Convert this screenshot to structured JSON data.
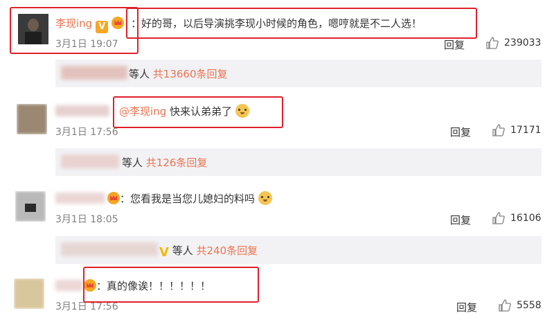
{
  "comments": [
    {
      "name": "李现ing",
      "text": "：好的哥，以后导演挑李现小时候的角色，嗯哼就是不二人选！",
      "time": "3月1日 19:07",
      "reply": "回复",
      "likes": "239033"
    },
    {
      "mention": "@李现ing",
      "text": " 快来认弟弟了",
      "time": "3月1日 17:56",
      "reply": "回复",
      "likes": "17171"
    },
    {
      "text": "：您看我是当您儿媳妇的料吗",
      "time": "3月1日 18:05",
      "reply": "回复",
      "likes": "16106"
    },
    {
      "text": "：真的像诶！！！！！！",
      "time": "3月1日 17:56",
      "reply": "回复",
      "likes": "5558"
    }
  ],
  "subreplies": [
    {
      "prefix": "等人",
      "link": "共13660条回复"
    },
    {
      "prefix": "等人",
      "link": "共126条回复"
    },
    {
      "prefix": "等人",
      "link": "共240条回复"
    }
  ]
}
